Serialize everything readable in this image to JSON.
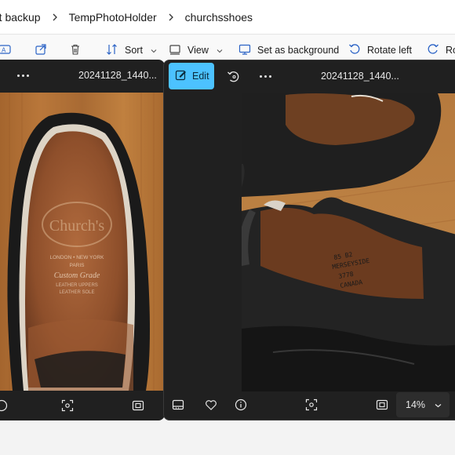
{
  "breadcrumb": {
    "items": [
      "rt backup",
      "TempPhotoHolder",
      "churchsshoes"
    ]
  },
  "commandbar": {
    "sort_label": "Sort",
    "view_label": "View",
    "set_background_label": "Set as background",
    "rotate_left_label": "Rotate left",
    "rotate_right_label": "Rot"
  },
  "viewer_left": {
    "filename": "20241128_1440..."
  },
  "viewer_right": {
    "edit_label": "Edit",
    "filename": "20241128_1440...",
    "zoom": "14%"
  },
  "photo_left": {
    "insole_brand": "Church's",
    "insole_cities": "LONDON • NEW YORK",
    "insole_city2": "PARIS",
    "insole_grade": "Custom Grade",
    "insole_line1": "LEATHER UPPERS",
    "insole_line2": "LEATHER SOLE"
  },
  "photo_right": {
    "handwriting_1": "85 B2",
    "handwriting_2": "MERSEYSIDE",
    "handwriting_3": "3778",
    "handwriting_4": "CANADA"
  },
  "colors": {
    "accent": "#4cc2ff",
    "viewer_bg": "#202020",
    "explorer_bg": "#f9f9f9"
  }
}
